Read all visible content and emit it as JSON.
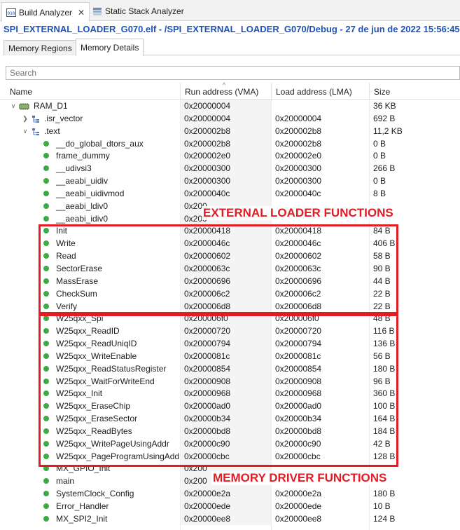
{
  "view_tabs": [
    {
      "label": "Build Analyzer",
      "active": true,
      "icon": "build-analyzer-icon"
    },
    {
      "label": "Static Stack Analyzer",
      "active": false,
      "icon": "stack-analyzer-icon"
    }
  ],
  "title": "SPI_EXTERNAL_LOADER_G070.elf - /SPI_EXTERNAL_LOADER_G070/Debug - 27 de jun de 2022 15:56:45",
  "sub_tabs": [
    {
      "label": "Memory Regions",
      "active": false
    },
    {
      "label": "Memory Details",
      "active": true
    }
  ],
  "search": {
    "placeholder": "Search"
  },
  "columns": [
    "Name",
    "Run address (VMA)",
    "Load address (LMA)",
    "Size"
  ],
  "rows": [
    {
      "name": "RAM_D1",
      "level": 0,
      "kind": "region",
      "expanded": true,
      "run": "0x20000004",
      "load": "",
      "size": "36 KB"
    },
    {
      "name": ".isr_vector",
      "level": 1,
      "kind": "section",
      "expanded": false,
      "run": "0x20000004",
      "load": "0x20000004",
      "size": "692 B"
    },
    {
      "name": ".text",
      "level": 1,
      "kind": "section",
      "expanded": true,
      "run": "0x200002b8",
      "load": "0x200002b8",
      "size": "11,2 KB"
    },
    {
      "name": "__do_global_dtors_aux",
      "level": 2,
      "kind": "symbol",
      "run": "0x200002b8",
      "load": "0x200002b8",
      "size": "0 B"
    },
    {
      "name": "frame_dummy",
      "level": 2,
      "kind": "symbol",
      "run": "0x200002e0",
      "load": "0x200002e0",
      "size": "0 B"
    },
    {
      "name": "__udivsi3",
      "level": 2,
      "kind": "symbol",
      "run": "0x20000300",
      "load": "0x20000300",
      "size": "266 B"
    },
    {
      "name": "__aeabi_uidiv",
      "level": 2,
      "kind": "symbol",
      "run": "0x20000300",
      "load": "0x20000300",
      "size": "0 B"
    },
    {
      "name": "__aeabi_uidivmod",
      "level": 2,
      "kind": "symbol",
      "run": "0x2000040c",
      "load": "0x2000040c",
      "size": "8 B"
    },
    {
      "name": "__aeabi_ldiv0",
      "level": 2,
      "kind": "symbol",
      "run": "0x200",
      "load": "",
      "size": ""
    },
    {
      "name": "__aeabi_idiv0",
      "level": 2,
      "kind": "symbol",
      "run": "0x200",
      "load": "",
      "size": ""
    },
    {
      "name": "Init",
      "level": 2,
      "kind": "symbol",
      "run": "0x20000418",
      "load": "0x20000418",
      "size": "84 B"
    },
    {
      "name": "Write",
      "level": 2,
      "kind": "symbol",
      "run": "0x2000046c",
      "load": "0x2000046c",
      "size": "406 B"
    },
    {
      "name": "Read",
      "level": 2,
      "kind": "symbol",
      "run": "0x20000602",
      "load": "0x20000602",
      "size": "58 B"
    },
    {
      "name": "SectorErase",
      "level": 2,
      "kind": "symbol",
      "run": "0x2000063c",
      "load": "0x2000063c",
      "size": "90 B"
    },
    {
      "name": "MassErase",
      "level": 2,
      "kind": "symbol",
      "run": "0x20000696",
      "load": "0x20000696",
      "size": "44 B"
    },
    {
      "name": "CheckSum",
      "level": 2,
      "kind": "symbol",
      "run": "0x200006c2",
      "load": "0x200006c2",
      "size": "22 B"
    },
    {
      "name": "Verify",
      "level": 2,
      "kind": "symbol",
      "run": "0x200006d8",
      "load": "0x200006d8",
      "size": "22 B"
    },
    {
      "name": "W25qxx_Spi",
      "level": 2,
      "kind": "symbol",
      "run": "0x200006f0",
      "load": "0x200006f0",
      "size": "48 B"
    },
    {
      "name": "W25qxx_ReadID",
      "level": 2,
      "kind": "symbol",
      "run": "0x20000720",
      "load": "0x20000720",
      "size": "116 B"
    },
    {
      "name": "W25qxx_ReadUniqID",
      "level": 2,
      "kind": "symbol",
      "run": "0x20000794",
      "load": "0x20000794",
      "size": "136 B"
    },
    {
      "name": "W25qxx_WriteEnable",
      "level": 2,
      "kind": "symbol",
      "run": "0x2000081c",
      "load": "0x2000081c",
      "size": "56 B"
    },
    {
      "name": "W25qxx_ReadStatusRegister",
      "level": 2,
      "kind": "symbol",
      "run": "0x20000854",
      "load": "0x20000854",
      "size": "180 B"
    },
    {
      "name": "W25qxx_WaitForWriteEnd",
      "level": 2,
      "kind": "symbol",
      "run": "0x20000908",
      "load": "0x20000908",
      "size": "96 B"
    },
    {
      "name": "W25qxx_Init",
      "level": 2,
      "kind": "symbol",
      "run": "0x20000968",
      "load": "0x20000968",
      "size": "360 B"
    },
    {
      "name": "W25qxx_EraseChip",
      "level": 2,
      "kind": "symbol",
      "run": "0x20000ad0",
      "load": "0x20000ad0",
      "size": "100 B"
    },
    {
      "name": "W25qxx_EraseSector",
      "level": 2,
      "kind": "symbol",
      "run": "0x20000b34",
      "load": "0x20000b34",
      "size": "164 B"
    },
    {
      "name": "W25qxx_ReadBytes",
      "level": 2,
      "kind": "symbol",
      "run": "0x20000bd8",
      "load": "0x20000bd8",
      "size": "184 B"
    },
    {
      "name": "W25qxx_WritePageUsingAddr",
      "level": 2,
      "kind": "symbol",
      "run": "0x20000c90",
      "load": "0x20000c90",
      "size": "42 B"
    },
    {
      "name": "W25qxx_PageProgramUsingAddr",
      "level": 2,
      "kind": "symbol",
      "run": "0x20000cbc",
      "load": "0x20000cbc",
      "size": "128 B"
    },
    {
      "name": "MX_GPIO_Init",
      "level": 2,
      "kind": "symbol",
      "run": "0x200",
      "load": "",
      "size": ""
    },
    {
      "name": "main",
      "level": 2,
      "kind": "symbol",
      "run": "0x200",
      "load": "",
      "size": ""
    },
    {
      "name": "SystemClock_Config",
      "level": 2,
      "kind": "symbol",
      "run": "0x20000e2a",
      "load": "0x20000e2a",
      "size": "180 B"
    },
    {
      "name": "Error_Handler",
      "level": 2,
      "kind": "symbol",
      "run": "0x20000ede",
      "load": "0x20000ede",
      "size": "10 B"
    },
    {
      "name": "MX_SPI2_Init",
      "level": 2,
      "kind": "symbol",
      "run": "0x20000ee8",
      "load": "0x20000ee8",
      "size": "124 B"
    }
  ],
  "annotations": [
    {
      "text": "EXTERNAL LOADER FUNCTIONS",
      "first_row": 10,
      "last_row": 16
    },
    {
      "text": "MEMORY DRIVER FUNCTIONS",
      "first_row": 17,
      "last_row": 28
    }
  ],
  "colors": {
    "title": "#1d52b8",
    "annotation": "#e21b25",
    "symbol_dot": "#3dab43"
  }
}
